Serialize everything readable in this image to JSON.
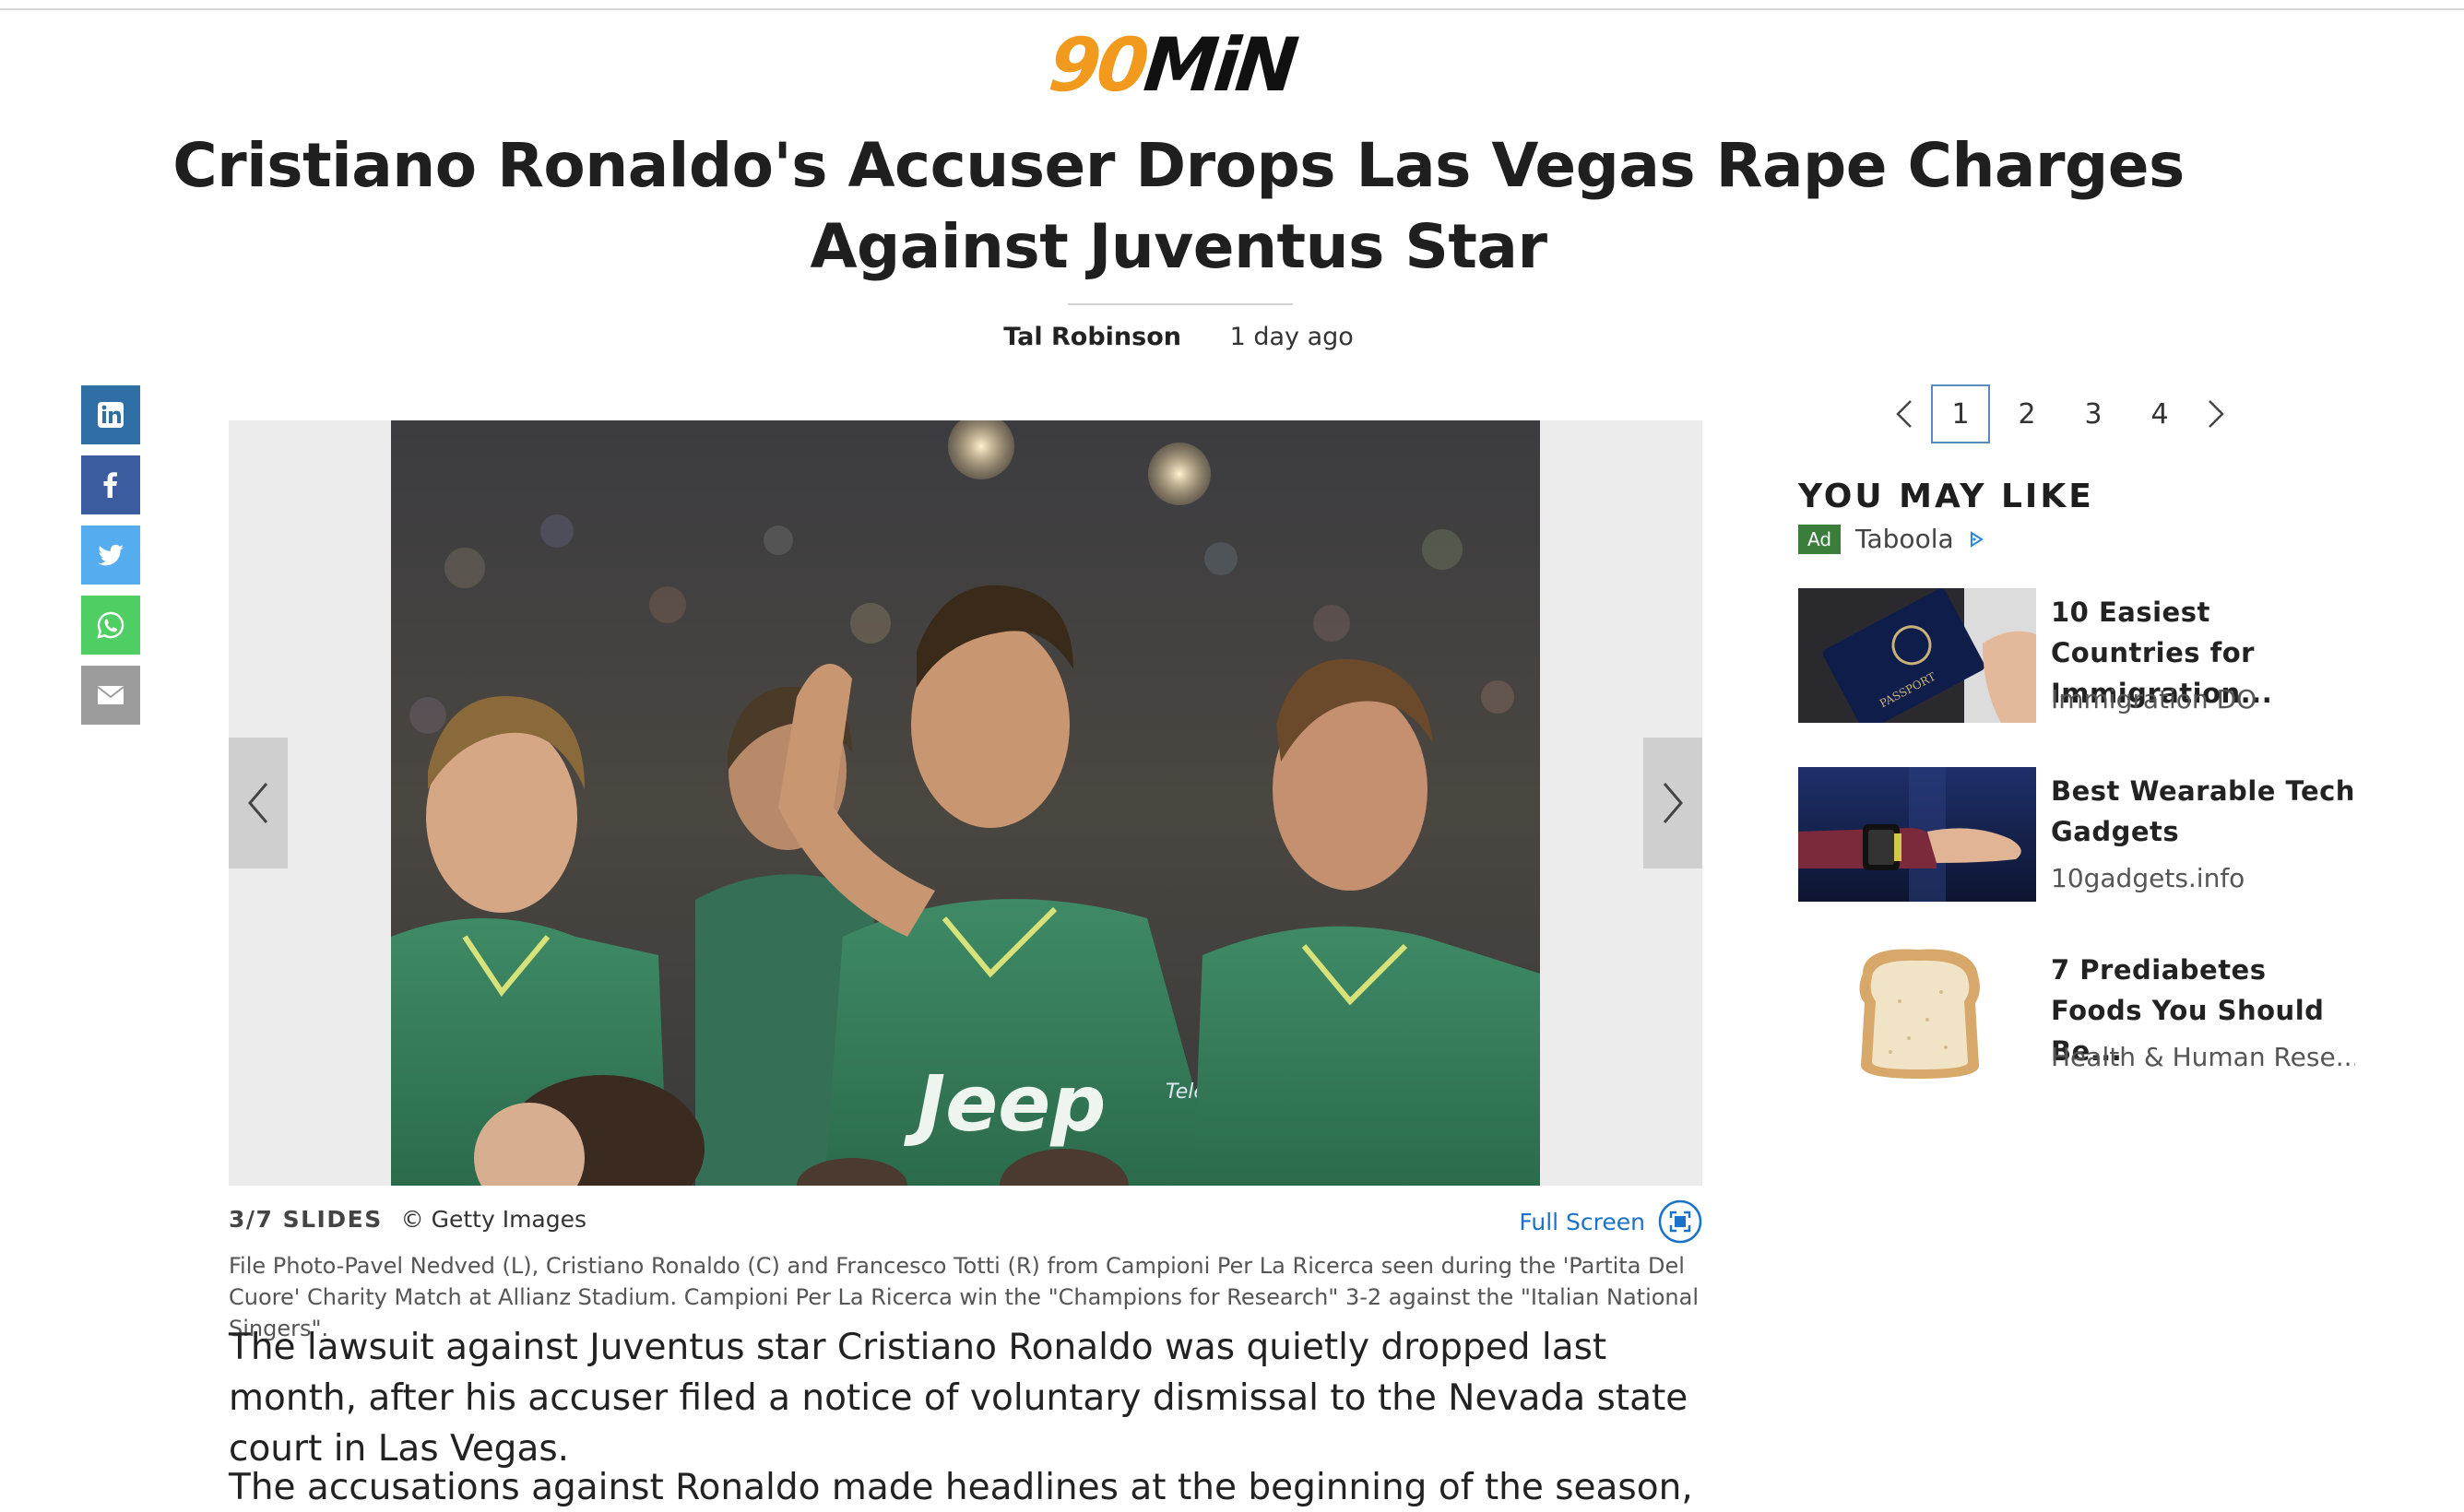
{
  "brand": {
    "logo_part1": "90",
    "logo_part2": "MiN",
    "accent": "#f29a1e"
  },
  "article": {
    "headline": "Cristiano Ronaldo's Accuser Drops Las Vegas Rape Charges Against Juventus Star",
    "author": "Tal Robinson",
    "published": "1 day ago",
    "paragraphs": [
      "The lawsuit against Juventus star Cristiano Ronaldo was quietly dropped last month, after his accuser filed a notice of voluntary dismissal to the Nevada state court in Las Vegas.",
      "The accusations against Ronaldo made headlines at the beginning of the season, leading"
    ]
  },
  "share": {
    "icons": [
      "linkedin-icon",
      "facebook-icon",
      "twitter-icon",
      "whatsapp-icon",
      "email-icon"
    ],
    "colors": [
      "#2f6fa6",
      "#3b5da0",
      "#55acee",
      "#4fce63",
      "#9c9c9c"
    ]
  },
  "slideshow": {
    "counter": "3/7 SLIDES",
    "credit": "© Getty Images",
    "fullscreen_label": "Full Screen",
    "caption": "File Photo-Pavel Nedved (L), Cristiano Ronaldo (C) and Francesco Totti (R) from Campioni Per La Ricerca seen during the 'Partita Del Cuore' Charity Match at Allianz Stadium. Campioni Per La Ricerca win the \"Champions for Research\" 3-2 against the \"Italian National Singers\".",
    "photo_text_1": "Jeep",
    "photo_text_2": "Telethon"
  },
  "pagination": {
    "pages": [
      "1",
      "2",
      "3",
      "4"
    ],
    "current": "1"
  },
  "sidebar": {
    "heading": "YOU MAY LIKE",
    "ad_badge": "Ad",
    "provider": "Taboola",
    "recommendations": [
      {
        "title": "10 Easiest Countries for Immigration...",
        "source": "Immigration DO",
        "thumb": "passport-image"
      },
      {
        "title": "Best Wearable Tech Gadgets",
        "source": "10gadgets.info",
        "thumb": "wearable-device-image"
      },
      {
        "title": "7 Prediabetes Foods You Should Be...",
        "source": "Health & Human Rese...",
        "thumb": "bread-slice-image"
      }
    ]
  }
}
